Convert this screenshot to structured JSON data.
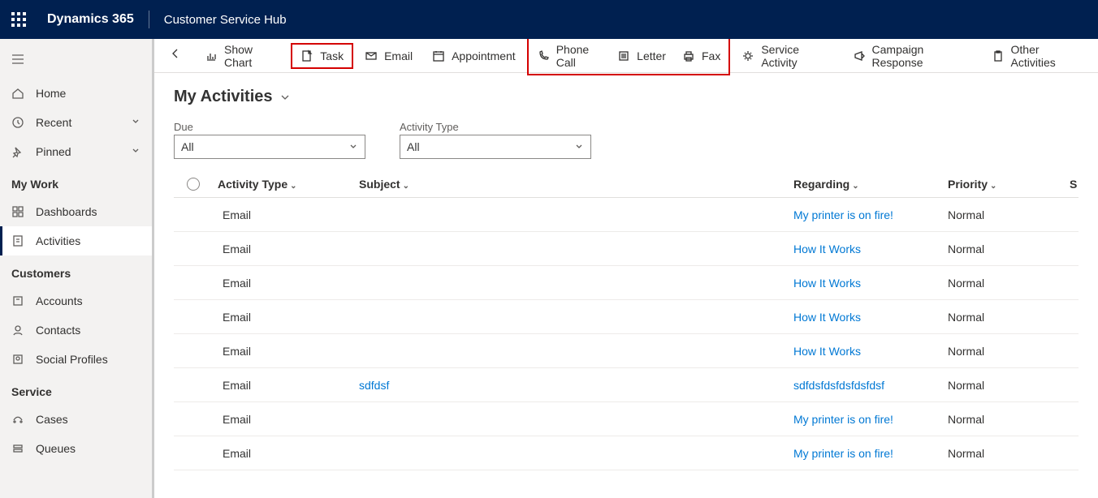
{
  "header": {
    "brand": "Dynamics 365",
    "app": "Customer Service Hub"
  },
  "sidebar": {
    "top": [
      {
        "label": "Home"
      },
      {
        "label": "Recent",
        "chev": true
      },
      {
        "label": "Pinned",
        "chev": true
      }
    ],
    "groups": [
      {
        "heading": "My Work",
        "items": [
          {
            "label": "Dashboards"
          },
          {
            "label": "Activities",
            "active": true
          }
        ]
      },
      {
        "heading": "Customers",
        "items": [
          {
            "label": "Accounts"
          },
          {
            "label": "Contacts"
          },
          {
            "label": "Social Profiles"
          }
        ]
      },
      {
        "heading": "Service",
        "items": [
          {
            "label": "Cases"
          },
          {
            "label": "Queues"
          }
        ]
      }
    ]
  },
  "commands": [
    {
      "label": "Show Chart"
    },
    {
      "label": "Task",
      "highlight": "single"
    },
    {
      "label": "Email"
    },
    {
      "label": "Appointment"
    },
    {
      "label": "Phone Call",
      "highlight": "group-start"
    },
    {
      "label": "Letter"
    },
    {
      "label": "Fax",
      "highlight": "group-end"
    },
    {
      "label": "Service Activity"
    },
    {
      "label": "Campaign Response"
    },
    {
      "label": "Other Activities"
    }
  ],
  "view": {
    "title": "My Activities"
  },
  "filters": {
    "due_label": "Due",
    "due_value": "All",
    "type_label": "Activity Type",
    "type_value": "All"
  },
  "columns": {
    "activitytype": "Activity Type",
    "subject": "Subject",
    "regarding": "Regarding",
    "priority": "Priority",
    "last": "S"
  },
  "rows": [
    {
      "activitytype": "Email",
      "subject": "",
      "regarding": "My printer is on fire!",
      "priority": "Normal"
    },
    {
      "activitytype": "Email",
      "subject": "",
      "regarding": "How It Works",
      "priority": "Normal"
    },
    {
      "activitytype": "Email",
      "subject": "",
      "regarding": "How It Works",
      "priority": "Normal"
    },
    {
      "activitytype": "Email",
      "subject": "",
      "regarding": "How It Works",
      "priority": "Normal"
    },
    {
      "activitytype": "Email",
      "subject": "",
      "regarding": "How It Works",
      "priority": "Normal"
    },
    {
      "activitytype": "Email",
      "subject": "sdfdsf",
      "regarding": "sdfdsfdsfdsfdsfdsf",
      "priority": "Normal"
    },
    {
      "activitytype": "Email",
      "subject": "",
      "regarding": "My printer is on fire!",
      "priority": "Normal"
    },
    {
      "activitytype": "Email",
      "subject": "",
      "regarding": "My printer is on fire!",
      "priority": "Normal"
    }
  ]
}
